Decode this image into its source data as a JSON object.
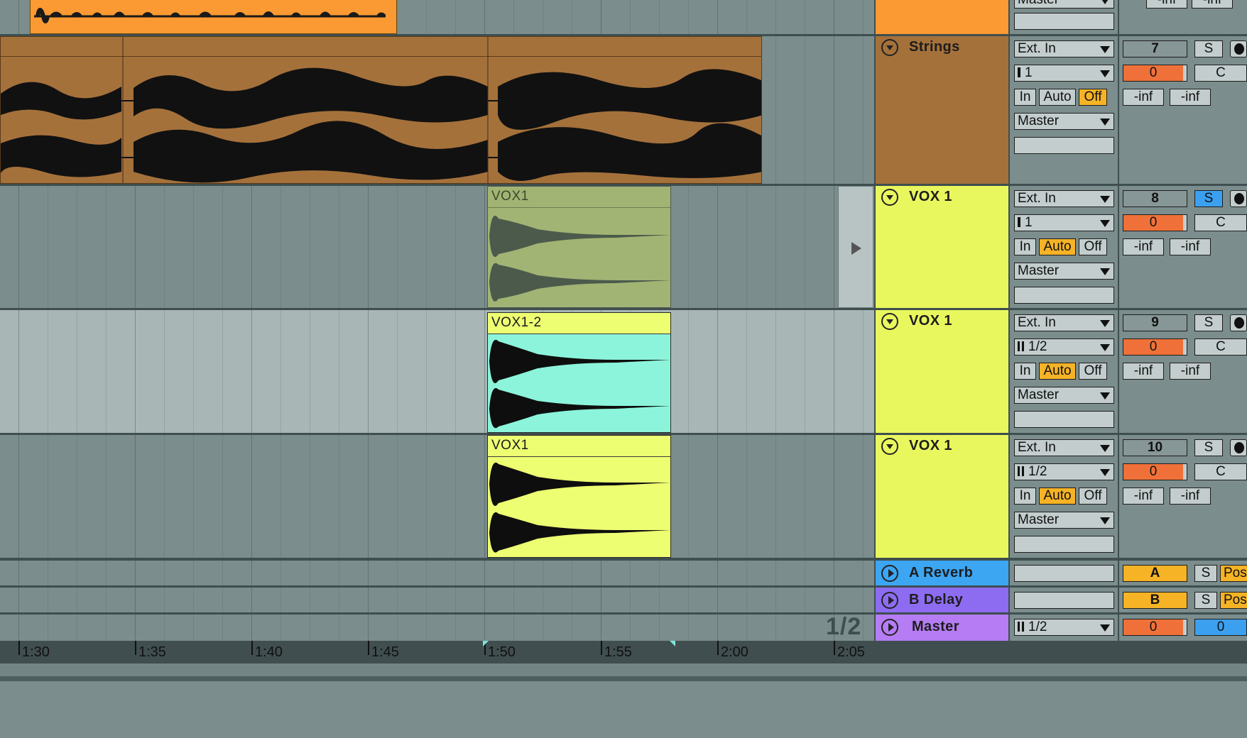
{
  "tracks": [
    {
      "name": "Strings",
      "input": "Ext. In",
      "channel": "1",
      "monitor": [
        "In",
        "Auto",
        "Off"
      ],
      "monitor_active": "Off",
      "output": "Master",
      "number": "7",
      "volume": "0",
      "pan": "C",
      "peak_l": "-inf",
      "peak_r": "-inf",
      "solo": "S",
      "color": "#a5713b"
    },
    {
      "name": "VOX 1",
      "input": "Ext. In",
      "channel": "1",
      "monitor": [
        "In",
        "Auto",
        "Off"
      ],
      "monitor_active": "Auto",
      "output": "Master",
      "number": "8",
      "volume": "0",
      "pan": "C",
      "peak_l": "-inf",
      "peak_r": "-inf",
      "solo": "S",
      "color": "#e9f75e"
    },
    {
      "name": "VOX 1",
      "input": "Ext. In",
      "channel": "1/2",
      "monitor": [
        "In",
        "Auto",
        "Off"
      ],
      "monitor_active": "Auto",
      "output": "Master",
      "number": "9",
      "volume": "0",
      "pan": "C",
      "peak_l": "-inf",
      "peak_r": "-inf",
      "solo": "S",
      "color": "#e9f75e"
    },
    {
      "name": "VOX 1",
      "input": "Ext. In",
      "channel": "1/2",
      "monitor": [
        "In",
        "Auto",
        "Off"
      ],
      "monitor_active": "Auto",
      "output": "Master",
      "number": "10",
      "volume": "0",
      "pan": "C",
      "peak_l": "-inf",
      "peak_r": "-inf",
      "solo": "S",
      "color": "#e9f75e"
    }
  ],
  "top_partial": {
    "output": "Master",
    "peak_l": "-inf",
    "peak_r": "-inf"
  },
  "clips": {
    "vox1_a": "VOX1",
    "vox1_2": "VOX1-2",
    "vox1_b": "VOX1"
  },
  "returns": [
    {
      "name": "A Reverb",
      "letter": "A",
      "solo": "S",
      "post": "Pos",
      "color": "#3ca6f3"
    },
    {
      "name": "B Delay",
      "letter": "B",
      "solo": "S",
      "post": "Pos",
      "color": "#8d6cf2"
    }
  ],
  "master": {
    "name": "Master",
    "channel": "1/2",
    "volume": "0",
    "pan": "0",
    "color": "#b57cf4"
  },
  "page_indicator": "1/2",
  "ruler": [
    "1:30",
    "1:35",
    "1:40",
    "1:45",
    "1:50",
    "1:55",
    "2:00",
    "2:05"
  ]
}
